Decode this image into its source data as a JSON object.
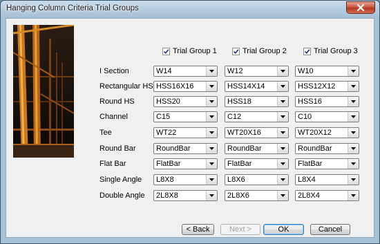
{
  "window": {
    "title": "Hanging Column Criteria Trial Groups"
  },
  "groups": [
    {
      "label": "Trial Group 1",
      "checked": true
    },
    {
      "label": "Trial Group 2",
      "checked": true
    },
    {
      "label": "Trial Group 3",
      "checked": true
    }
  ],
  "rows": [
    {
      "label": "I Section",
      "values": [
        "W14",
        "W12",
        "W10"
      ]
    },
    {
      "label": "Rectangular HS",
      "values": [
        "HSS16X16",
        "HSS14X14",
        "HSS12X12"
      ]
    },
    {
      "label": "Round HS",
      "values": [
        "HSS20",
        "HSS18",
        "HSS16"
      ]
    },
    {
      "label": "Channel",
      "values": [
        "C15",
        "C12",
        "C10"
      ]
    },
    {
      "label": "Tee",
      "values": [
        "WT22",
        "WT20X16",
        "WT20X12"
      ]
    },
    {
      "label": "Round Bar",
      "values": [
        "RoundBar",
        "RoundBar",
        "RoundBar"
      ]
    },
    {
      "label": "Flat Bar",
      "values": [
        "FlatBar",
        "FlatBar",
        "FlatBar"
      ]
    },
    {
      "label": "Single Angle",
      "values": [
        "L8X8",
        "L8X6",
        "L8X4"
      ]
    },
    {
      "label": "Double Angle",
      "values": [
        "2L8X8",
        "2L8X6",
        "2L8X4"
      ]
    }
  ],
  "buttons": {
    "back": "< Back",
    "next": "Next >",
    "ok": "OK",
    "cancel": "Cancel"
  },
  "icons": {
    "close": "close-icon",
    "check": "checkmark-icon",
    "dropdown": "dropdown-arrow-icon"
  }
}
